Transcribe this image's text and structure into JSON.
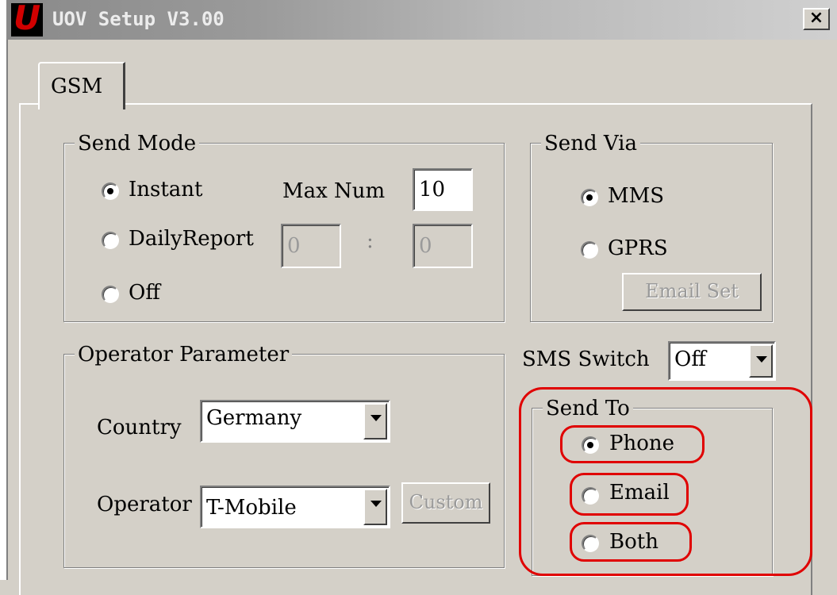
{
  "window": {
    "title": "UOV Setup V3.00",
    "logo_letter": "U",
    "close_label": "×"
  },
  "tabs": [
    {
      "label": "GSM",
      "selected": true
    }
  ],
  "send_mode": {
    "legend": "Send Mode",
    "options": [
      {
        "label": "Instant",
        "checked": true
      },
      {
        "label": "DailyReport",
        "checked": false
      },
      {
        "label": "Off",
        "checked": false
      }
    ],
    "max_num_label": "Max Num",
    "max_num_value": "10",
    "daily_hour": "0",
    "time_separator": ":",
    "daily_minute": "0"
  },
  "send_via": {
    "legend": "Send Via",
    "options": [
      {
        "label": "MMS",
        "checked": true
      },
      {
        "label": "GPRS",
        "checked": false
      }
    ],
    "email_set_label": "Email Set"
  },
  "sms_switch": {
    "label": "SMS Switch",
    "value": "Off"
  },
  "operator_parameter": {
    "legend": "Operator Parameter",
    "country_label": "Country",
    "country_value": "Germany",
    "operator_label": "Operator",
    "operator_value": "T-Mobile",
    "custom_label": "Custom"
  },
  "send_to": {
    "legend": "Send To",
    "options": [
      {
        "label": "Phone",
        "checked": true
      },
      {
        "label": "Email",
        "checked": false
      },
      {
        "label": "Both",
        "checked": false
      }
    ]
  },
  "colors": {
    "highlight": "#e00000",
    "dialog_bg": "#d4d0c8",
    "logo_red": "#d00000"
  }
}
